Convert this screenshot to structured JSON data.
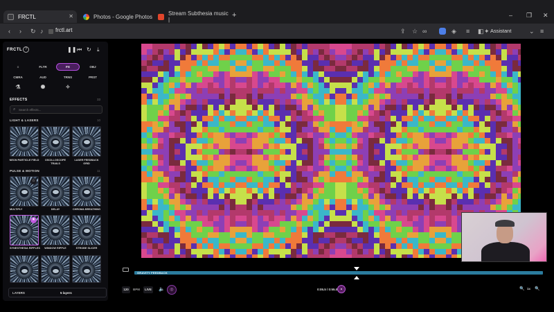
{
  "browser": {
    "tabs": [
      {
        "label": "FRCTL",
        "active": true,
        "favicon_color": "#2b2b2b"
      },
      {
        "label": "Photos - Google Photos",
        "active": false,
        "favicon_color": "#f2a33a"
      },
      {
        "label": "Stream Subthesia music |",
        "active": false,
        "favicon_color": "#e0452b"
      }
    ],
    "new_tab_icon": "+",
    "window_controls": {
      "minimize": "–",
      "maximize": "❐",
      "close": "✕"
    },
    "url": "frctl.art",
    "assistant_label": "Assistant"
  },
  "sidebar": {
    "logo": "FRCTL",
    "help_icon": "?",
    "controls": {
      "pause": "❚❚",
      "skip_back": "⏮",
      "reset": "↻",
      "download": "⤓"
    },
    "modes_row1": [
      "≡",
      "FLTR",
      "FX",
      "OBJ"
    ],
    "modes_row2": [
      "CMRA",
      "AUD",
      "TRNS",
      "PRST"
    ],
    "modes_row3": [
      "⚗",
      "✺",
      "✧"
    ],
    "active_mode": "FX",
    "effects_title": "EFFECTS",
    "effects_count": "33",
    "search_placeholder": "Search effects...",
    "light_category": {
      "title": "LIGHT & LASERS",
      "count": "10",
      "items": [
        {
          "label": "NEON PARTICLE FIELD"
        },
        {
          "label": "OSCILLOSCOPE TRAILS"
        },
        {
          "label": "LASER FEEDBACK GRID"
        }
      ]
    },
    "pulse_category": {
      "title": "PULSE & MOTION",
      "count": "11",
      "items": [
        {
          "label": "MULTIPLY"
        },
        {
          "label": "DELAY"
        },
        {
          "label": "CHROMA BREATHING"
        },
        {
          "label": "SYNESTHESIA RIPPLES"
        },
        {
          "label": "WINDOW RIPPLE"
        },
        {
          "label": "STROBE SLICER"
        },
        {
          "label": ""
        },
        {
          "label": ""
        },
        {
          "label": ""
        }
      ]
    },
    "layers_label": "LAYERS",
    "layers_value": "5 layers"
  },
  "timeline": {
    "label": "GRAVITY FEEDBACK",
    "accent_color": "#2b7c9e",
    "playhead_position": 0.54
  },
  "transport": {
    "bpm_value": "120",
    "bpm_label": "BPM",
    "live_label": "LIVE",
    "volume_icon": "🔈",
    "audio_icon": "◎",
    "time_display": "0:05.5 / 0:55.0",
    "record_label": "●",
    "zoom_out_icon": "🔍",
    "zoom_level": "1x",
    "zoom_in_icon": "🔍"
  },
  "canvas": {
    "palette": [
      "#7a2a3e",
      "#b3396b",
      "#8d3fb5",
      "#d8488e",
      "#e8a23a",
      "#6fd14a",
      "#3bb7c9",
      "#f07a3a",
      "#c6e04a",
      "#5a2fb0"
    ]
  }
}
